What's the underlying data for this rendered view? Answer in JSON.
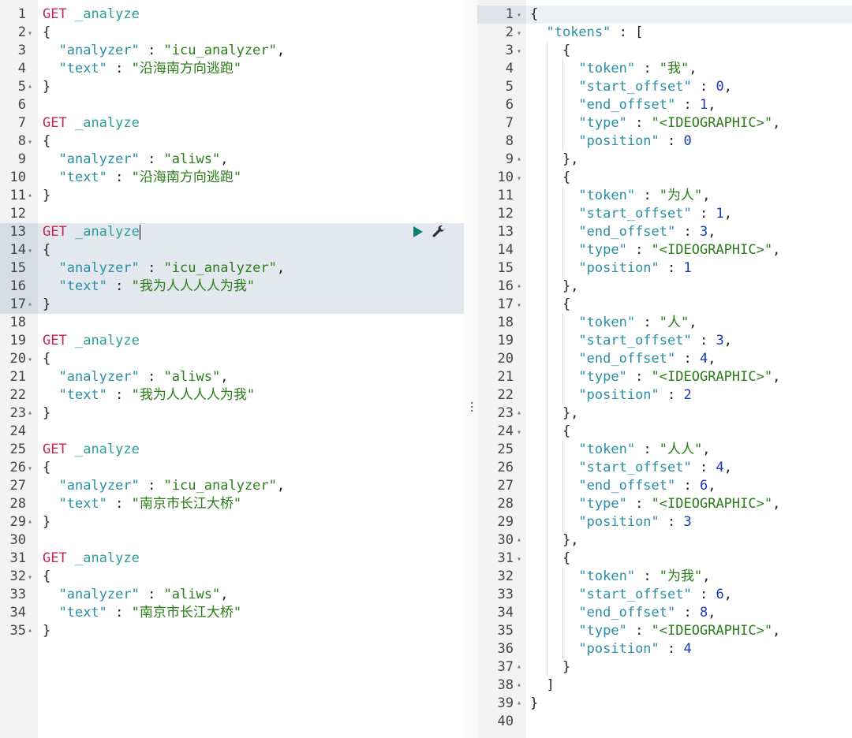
{
  "request_editor": {
    "lines": [
      [
        [
          "m",
          "GET"
        ],
        [
          "s",
          " "
        ],
        [
          "p",
          "_analyze"
        ]
      ],
      [
        [
          "u",
          "{"
        ]
      ],
      [
        [
          "s",
          "  "
        ],
        [
          "k",
          "\"analyzer\""
        ],
        [
          "u",
          " : "
        ],
        [
          "t",
          "\"icu_analyzer\""
        ],
        [
          "u",
          ","
        ]
      ],
      [
        [
          "s",
          "  "
        ],
        [
          "k",
          "\"text\""
        ],
        [
          "u",
          " : "
        ],
        [
          "t",
          "\"沿海南方向逃跑\""
        ]
      ],
      [
        [
          "u",
          "}"
        ]
      ],
      [],
      [
        [
          "m",
          "GET"
        ],
        [
          "s",
          " "
        ],
        [
          "p",
          "_analyze"
        ]
      ],
      [
        [
          "u",
          "{"
        ]
      ],
      [
        [
          "s",
          "  "
        ],
        [
          "k",
          "\"analyzer\""
        ],
        [
          "u",
          " : "
        ],
        [
          "t",
          "\"aliws\""
        ],
        [
          "u",
          ","
        ]
      ],
      [
        [
          "s",
          "  "
        ],
        [
          "k",
          "\"text\""
        ],
        [
          "u",
          " : "
        ],
        [
          "t",
          "\"沿海南方向逃跑\""
        ]
      ],
      [
        [
          "u",
          "}"
        ]
      ],
      [],
      [
        [
          "m",
          "GET"
        ],
        [
          "s",
          " "
        ],
        [
          "p",
          "_analyze"
        ]
      ],
      [
        [
          "u",
          "{"
        ]
      ],
      [
        [
          "s",
          "  "
        ],
        [
          "k",
          "\"analyzer\""
        ],
        [
          "u",
          " : "
        ],
        [
          "t",
          "\"icu_analyzer\""
        ],
        [
          "u",
          ","
        ]
      ],
      [
        [
          "s",
          "  "
        ],
        [
          "k",
          "\"text\""
        ],
        [
          "u",
          " : "
        ],
        [
          "t",
          "\"我为人人人人为我\""
        ]
      ],
      [
        [
          "u",
          "}"
        ]
      ],
      [],
      [
        [
          "m",
          "GET"
        ],
        [
          "s",
          " "
        ],
        [
          "p",
          "_analyze"
        ]
      ],
      [
        [
          "u",
          "{"
        ]
      ],
      [
        [
          "s",
          "  "
        ],
        [
          "k",
          "\"analyzer\""
        ],
        [
          "u",
          " : "
        ],
        [
          "t",
          "\"aliws\""
        ],
        [
          "u",
          ","
        ]
      ],
      [
        [
          "s",
          "  "
        ],
        [
          "k",
          "\"text\""
        ],
        [
          "u",
          " : "
        ],
        [
          "t",
          "\"我为人人人人为我\""
        ]
      ],
      [
        [
          "u",
          "}"
        ]
      ],
      [],
      [
        [
          "m",
          "GET"
        ],
        [
          "s",
          " "
        ],
        [
          "p",
          "_analyze"
        ]
      ],
      [
        [
          "u",
          "{"
        ]
      ],
      [
        [
          "s",
          "  "
        ],
        [
          "k",
          "\"analyzer\""
        ],
        [
          "u",
          " : "
        ],
        [
          "t",
          "\"icu_analyzer\""
        ],
        [
          "u",
          ","
        ]
      ],
      [
        [
          "s",
          "  "
        ],
        [
          "k",
          "\"text\""
        ],
        [
          "u",
          " : "
        ],
        [
          "t",
          "\"南京市长江大桥\""
        ]
      ],
      [
        [
          "u",
          "}"
        ]
      ],
      [],
      [
        [
          "m",
          "GET"
        ],
        [
          "s",
          " "
        ],
        [
          "p",
          "_analyze"
        ]
      ],
      [
        [
          "u",
          "{"
        ]
      ],
      [
        [
          "s",
          "  "
        ],
        [
          "k",
          "\"analyzer\""
        ],
        [
          "u",
          " : "
        ],
        [
          "t",
          "\"aliws\""
        ],
        [
          "u",
          ","
        ]
      ],
      [
        [
          "s",
          "  "
        ],
        [
          "k",
          "\"text\""
        ],
        [
          "u",
          " : "
        ],
        [
          "t",
          "\"南京市长江大桥\""
        ]
      ],
      [
        [
          "u",
          "}"
        ]
      ]
    ],
    "fold_open_lines": [
      2,
      8,
      14,
      20,
      26,
      32
    ],
    "fold_close_lines": [
      5,
      11,
      17,
      23,
      29,
      35
    ],
    "highlight_lines": [
      13,
      14,
      15,
      16,
      17
    ],
    "cursor_line": 13
  },
  "response_viewer": {
    "lines": [
      [
        [
          "u",
          "{"
        ]
      ],
      [
        [
          "s",
          "  "
        ],
        [
          "k",
          "\"tokens\""
        ],
        [
          "u",
          " : ["
        ]
      ],
      [
        [
          "s",
          "    "
        ],
        [
          "u",
          "{"
        ]
      ],
      [
        [
          "s",
          "      "
        ],
        [
          "k",
          "\"token\""
        ],
        [
          "u",
          " : "
        ],
        [
          "t",
          "\"我\""
        ],
        [
          "u",
          ","
        ]
      ],
      [
        [
          "s",
          "      "
        ],
        [
          "k",
          "\"start_offset\""
        ],
        [
          "u",
          " : "
        ],
        [
          "n",
          "0"
        ],
        [
          "u",
          ","
        ]
      ],
      [
        [
          "s",
          "      "
        ],
        [
          "k",
          "\"end_offset\""
        ],
        [
          "u",
          " : "
        ],
        [
          "n",
          "1"
        ],
        [
          "u",
          ","
        ]
      ],
      [
        [
          "s",
          "      "
        ],
        [
          "k",
          "\"type\""
        ],
        [
          "u",
          " : "
        ],
        [
          "t",
          "\"<IDEOGRAPHIC>\""
        ],
        [
          "u",
          ","
        ]
      ],
      [
        [
          "s",
          "      "
        ],
        [
          "k",
          "\"position\""
        ],
        [
          "u",
          " : "
        ],
        [
          "n",
          "0"
        ]
      ],
      [
        [
          "s",
          "    "
        ],
        [
          "u",
          "},"
        ]
      ],
      [
        [
          "s",
          "    "
        ],
        [
          "u",
          "{"
        ]
      ],
      [
        [
          "s",
          "      "
        ],
        [
          "k",
          "\"token\""
        ],
        [
          "u",
          " : "
        ],
        [
          "t",
          "\"为人\""
        ],
        [
          "u",
          ","
        ]
      ],
      [
        [
          "s",
          "      "
        ],
        [
          "k",
          "\"start_offset\""
        ],
        [
          "u",
          " : "
        ],
        [
          "n",
          "1"
        ],
        [
          "u",
          ","
        ]
      ],
      [
        [
          "s",
          "      "
        ],
        [
          "k",
          "\"end_offset\""
        ],
        [
          "u",
          " : "
        ],
        [
          "n",
          "3"
        ],
        [
          "u",
          ","
        ]
      ],
      [
        [
          "s",
          "      "
        ],
        [
          "k",
          "\"type\""
        ],
        [
          "u",
          " : "
        ],
        [
          "t",
          "\"<IDEOGRAPHIC>\""
        ],
        [
          "u",
          ","
        ]
      ],
      [
        [
          "s",
          "      "
        ],
        [
          "k",
          "\"position\""
        ],
        [
          "u",
          " : "
        ],
        [
          "n",
          "1"
        ]
      ],
      [
        [
          "s",
          "    "
        ],
        [
          "u",
          "},"
        ]
      ],
      [
        [
          "s",
          "    "
        ],
        [
          "u",
          "{"
        ]
      ],
      [
        [
          "s",
          "      "
        ],
        [
          "k",
          "\"token\""
        ],
        [
          "u",
          " : "
        ],
        [
          "t",
          "\"人\""
        ],
        [
          "u",
          ","
        ]
      ],
      [
        [
          "s",
          "      "
        ],
        [
          "k",
          "\"start_offset\""
        ],
        [
          "u",
          " : "
        ],
        [
          "n",
          "3"
        ],
        [
          "u",
          ","
        ]
      ],
      [
        [
          "s",
          "      "
        ],
        [
          "k",
          "\"end_offset\""
        ],
        [
          "u",
          " : "
        ],
        [
          "n",
          "4"
        ],
        [
          "u",
          ","
        ]
      ],
      [
        [
          "s",
          "      "
        ],
        [
          "k",
          "\"type\""
        ],
        [
          "u",
          " : "
        ],
        [
          "t",
          "\"<IDEOGRAPHIC>\""
        ],
        [
          "u",
          ","
        ]
      ],
      [
        [
          "s",
          "      "
        ],
        [
          "k",
          "\"position\""
        ],
        [
          "u",
          " : "
        ],
        [
          "n",
          "2"
        ]
      ],
      [
        [
          "s",
          "    "
        ],
        [
          "u",
          "},"
        ]
      ],
      [
        [
          "s",
          "    "
        ],
        [
          "u",
          "{"
        ]
      ],
      [
        [
          "s",
          "      "
        ],
        [
          "k",
          "\"token\""
        ],
        [
          "u",
          " : "
        ],
        [
          "t",
          "\"人人\""
        ],
        [
          "u",
          ","
        ]
      ],
      [
        [
          "s",
          "      "
        ],
        [
          "k",
          "\"start_offset\""
        ],
        [
          "u",
          " : "
        ],
        [
          "n",
          "4"
        ],
        [
          "u",
          ","
        ]
      ],
      [
        [
          "s",
          "      "
        ],
        [
          "k",
          "\"end_offset\""
        ],
        [
          "u",
          " : "
        ],
        [
          "n",
          "6"
        ],
        [
          "u",
          ","
        ]
      ],
      [
        [
          "s",
          "      "
        ],
        [
          "k",
          "\"type\""
        ],
        [
          "u",
          " : "
        ],
        [
          "t",
          "\"<IDEOGRAPHIC>\""
        ],
        [
          "u",
          ","
        ]
      ],
      [
        [
          "s",
          "      "
        ],
        [
          "k",
          "\"position\""
        ],
        [
          "u",
          " : "
        ],
        [
          "n",
          "3"
        ]
      ],
      [
        [
          "s",
          "    "
        ],
        [
          "u",
          "},"
        ]
      ],
      [
        [
          "s",
          "    "
        ],
        [
          "u",
          "{"
        ]
      ],
      [
        [
          "s",
          "      "
        ],
        [
          "k",
          "\"token\""
        ],
        [
          "u",
          " : "
        ],
        [
          "t",
          "\"为我\""
        ],
        [
          "u",
          ","
        ]
      ],
      [
        [
          "s",
          "      "
        ],
        [
          "k",
          "\"start_offset\""
        ],
        [
          "u",
          " : "
        ],
        [
          "n",
          "6"
        ],
        [
          "u",
          ","
        ]
      ],
      [
        [
          "s",
          "      "
        ],
        [
          "k",
          "\"end_offset\""
        ],
        [
          "u",
          " : "
        ],
        [
          "n",
          "8"
        ],
        [
          "u",
          ","
        ]
      ],
      [
        [
          "s",
          "      "
        ],
        [
          "k",
          "\"type\""
        ],
        [
          "u",
          " : "
        ],
        [
          "t",
          "\"<IDEOGRAPHIC>\""
        ],
        [
          "u",
          ","
        ]
      ],
      [
        [
          "s",
          "      "
        ],
        [
          "k",
          "\"position\""
        ],
        [
          "u",
          " : "
        ],
        [
          "n",
          "4"
        ]
      ],
      [
        [
          "s",
          "    "
        ],
        [
          "u",
          "}"
        ]
      ],
      [
        [
          "s",
          "  "
        ],
        [
          "u",
          "]"
        ]
      ],
      [
        [
          "u",
          "}"
        ]
      ],
      []
    ],
    "fold_open_lines": [
      1,
      2,
      3,
      10,
      17,
      24,
      31
    ],
    "fold_close_lines": [
      9,
      16,
      23,
      30,
      37,
      38,
      39
    ],
    "current_line": 1
  },
  "icons": {
    "run": "play-icon",
    "settings": "wrench-icon",
    "resizer": "drag-handle-icon"
  },
  "colors": {
    "method": "#c7254e",
    "path": "#2b9d9b",
    "key": "#2a8fa6",
    "string": "#2a7d18",
    "number": "#1a39b8",
    "run": "#157c74"
  }
}
